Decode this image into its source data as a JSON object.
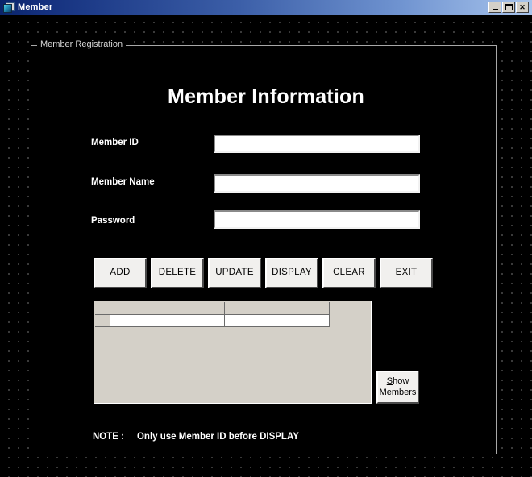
{
  "window": {
    "title": "Member",
    "icon": "vb-form-icon",
    "controls": [
      {
        "name": "minimize",
        "label": "_"
      },
      {
        "name": "maximize",
        "label": "□"
      },
      {
        "name": "close",
        "label": "✕"
      }
    ]
  },
  "frame": {
    "caption": "Member Registration"
  },
  "heading": {
    "title": "Member Information"
  },
  "fields": [
    {
      "id": "member-id",
      "label": "Member ID",
      "value": "",
      "placeholder": ""
    },
    {
      "id": "member-name",
      "label": "Member Name",
      "value": "",
      "placeholder": ""
    },
    {
      "id": "password",
      "label": "Password",
      "value": "",
      "placeholder": ""
    }
  ],
  "buttons": [
    {
      "id": "add",
      "accel": "A",
      "rest": "DD"
    },
    {
      "id": "delete",
      "accel": "D",
      "rest": "ELETE"
    },
    {
      "id": "update",
      "accel": "U",
      "rest": "PDATE"
    },
    {
      "id": "display",
      "accel": "D",
      "rest": "ISPLAY"
    },
    {
      "id": "clear",
      "accel": "C",
      "rest": "LEAR"
    },
    {
      "id": "exit",
      "accel": "E",
      "rest": "XIT"
    }
  ],
  "grid": {
    "header": [
      "",
      "",
      ""
    ],
    "rows": [
      [
        "",
        "",
        ""
      ]
    ]
  },
  "show_members": {
    "accel": "S",
    "rest_line1": "how",
    "line2": "Members"
  },
  "note": {
    "label": "NOTE :",
    "text": "Only use Member ID before DISPLAY"
  },
  "colors": {
    "form_background": "#000000",
    "title_bar_start": "#0a246a",
    "title_bar_end": "#a8c4ec",
    "button_face": "#f1f0ee",
    "grid_face": "#d4d0c8",
    "text": "#ffffff"
  }
}
